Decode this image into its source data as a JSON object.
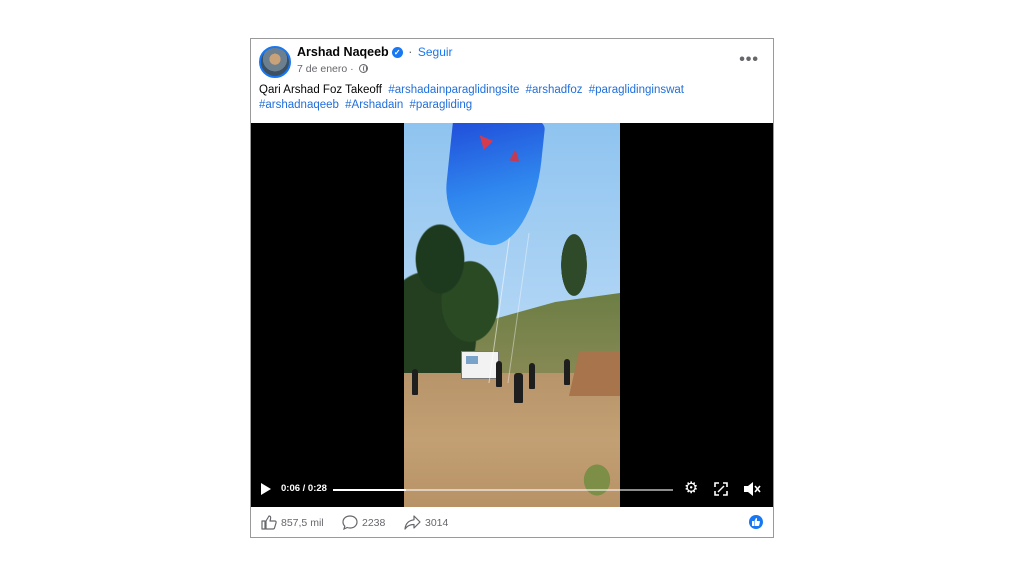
{
  "post": {
    "author": "Arshad Naqeeb",
    "follow_label": "Seguir",
    "date": "7 de enero",
    "meta_separator": "·",
    "caption_text": "Qari Arshad Foz Takeoff",
    "hashtags": [
      "#arshadainparaglidingsite",
      "#arshadfoz",
      "#paraglidinginswat",
      "#arshadnaqeeb",
      "#Arshadain",
      "#paragliding"
    ],
    "more_label": "•••"
  },
  "video": {
    "current_time": "0:06",
    "duration": "0:28",
    "time_display": "0:06 / 0:28",
    "progress_fraction": 0.214
  },
  "engagement": {
    "likes": "857,5 mil",
    "comments": "2238",
    "shares": "3014"
  },
  "colors": {
    "accent": "#1877f2",
    "hashtag": "#216fdb",
    "muted_text": "#65676b"
  },
  "icons": [
    "verified-badge-icon",
    "globe-icon",
    "more-options-icon",
    "play-icon",
    "settings-gear-icon",
    "fullscreen-icon",
    "mute-icon",
    "like-icon",
    "comment-icon",
    "share-icon"
  ]
}
